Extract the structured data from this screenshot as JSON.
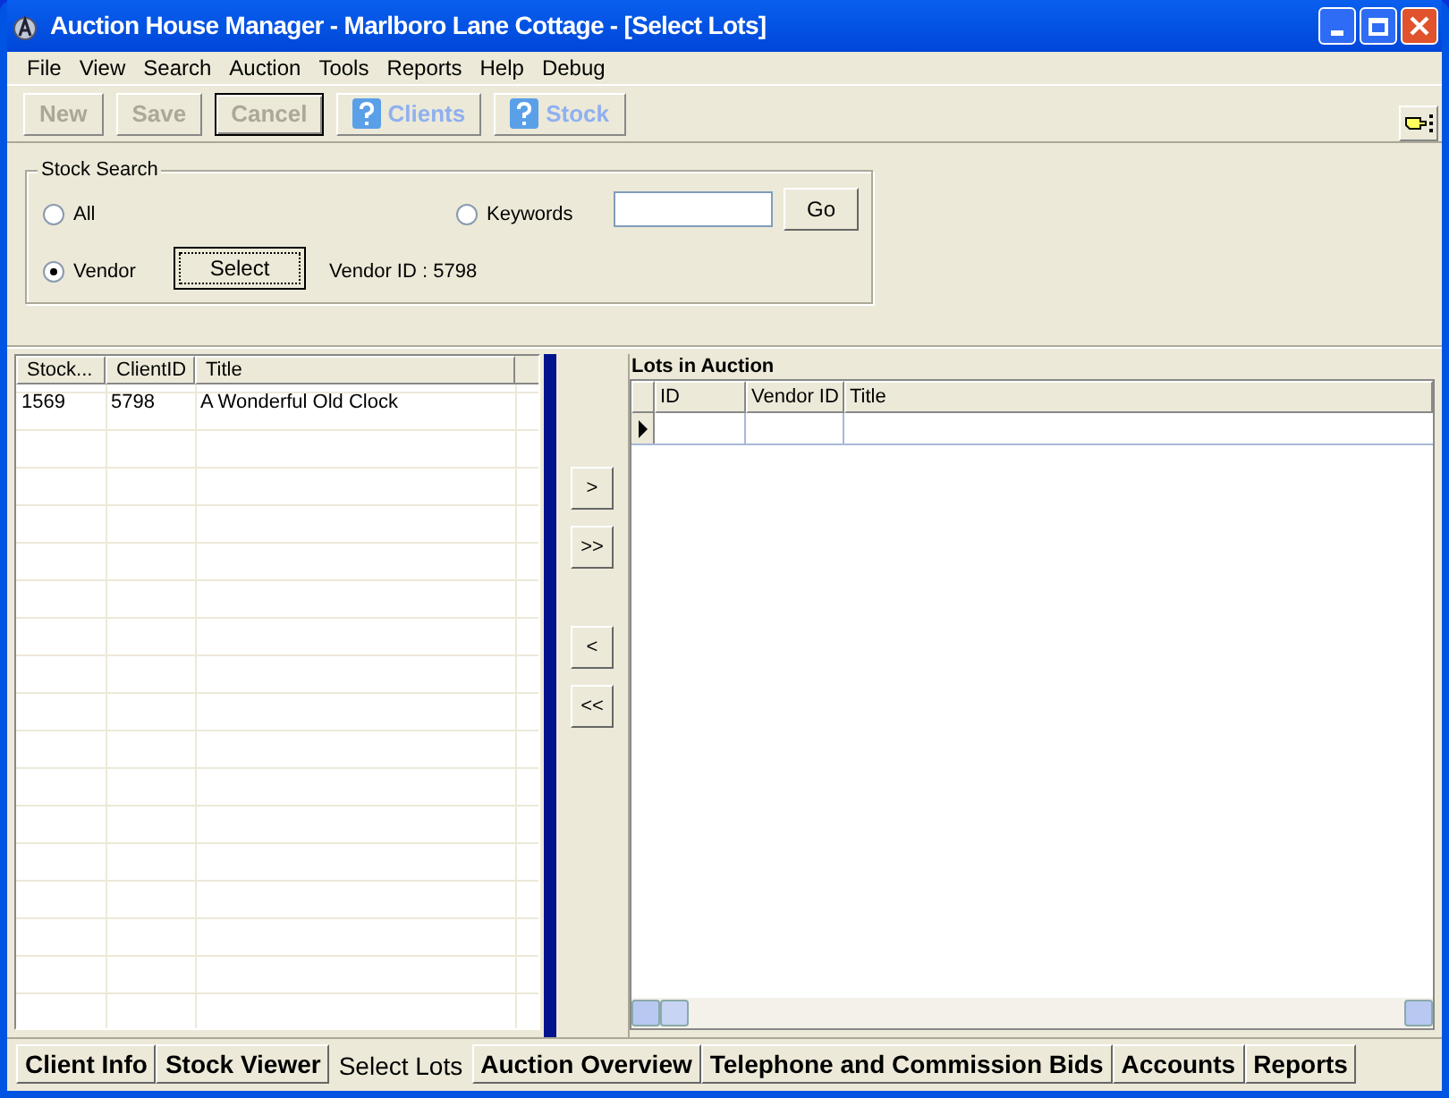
{
  "window": {
    "title": "Auction House Manager - Marlboro Lane Cottage - [Select Lots]"
  },
  "menu": [
    "File",
    "View",
    "Search",
    "Auction",
    "Tools",
    "Reports",
    "Help",
    "Debug"
  ],
  "toolbar": [
    {
      "label": "New",
      "kind": "plain",
      "disabled": true,
      "default": false
    },
    {
      "label": "Save",
      "kind": "plain",
      "disabled": true,
      "default": false
    },
    {
      "label": "Cancel",
      "kind": "plain",
      "disabled": true,
      "default": true
    },
    {
      "label": "Clients",
      "kind": "help",
      "disabled": true,
      "default": false
    },
    {
      "label": "Stock",
      "kind": "help",
      "disabled": true,
      "default": false
    }
  ],
  "stock_search": {
    "legend": "Stock Search",
    "options": [
      {
        "label": "All",
        "selected": false
      },
      {
        "label": "Vendor",
        "selected": true
      },
      {
        "label": "Keywords",
        "selected": false
      }
    ],
    "go_button": "Go",
    "select_button": "Select",
    "vendor_id": "Vendor ID : 5798"
  },
  "stock_table": {
    "columns": [
      "Stock...",
      "ClientID",
      "Title"
    ],
    "rows": [
      [
        "1569",
        "5798",
        "A Wonderful Old Clock"
      ]
    ]
  },
  "move_buttons": [
    ">",
    ">>",
    "<",
    "<<"
  ],
  "lots_table": {
    "title": "Lots in Auction",
    "columns": [
      "ID",
      "Vendor ID",
      "Title"
    ]
  },
  "tabs": [
    {
      "label": "Client Info",
      "selected": false
    },
    {
      "label": "Stock Viewer",
      "selected": false
    },
    {
      "label": "Select Lots",
      "selected": true
    },
    {
      "label": "Auction Overview",
      "selected": false
    },
    {
      "label": "Telephone and Commission Bids",
      "selected": false
    },
    {
      "label": "Accounts",
      "selected": false
    },
    {
      "label": "Reports",
      "selected": false
    }
  ]
}
